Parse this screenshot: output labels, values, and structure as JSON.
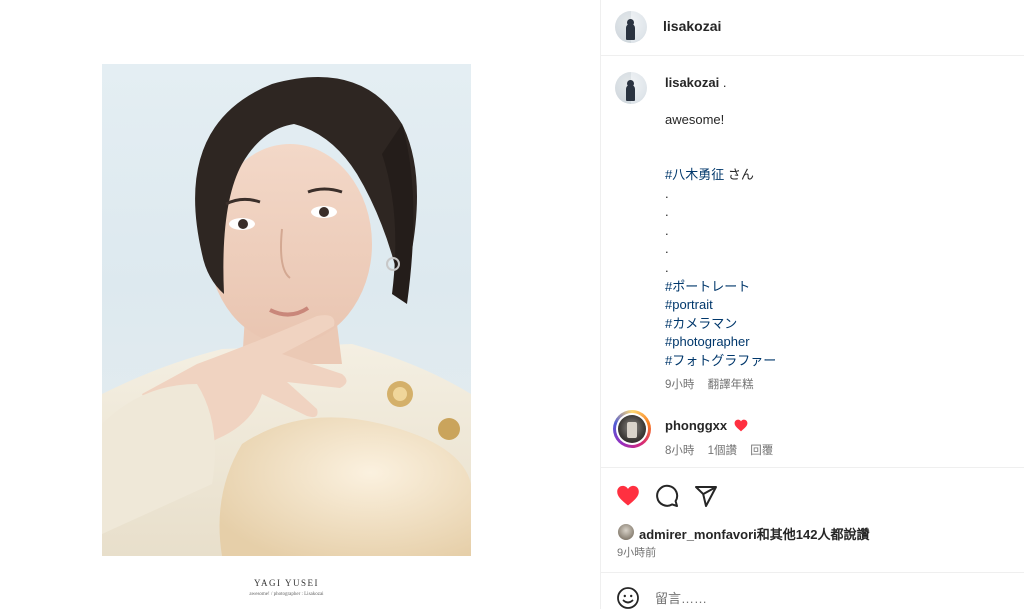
{
  "post": {
    "username": "lisakozai",
    "photo_caption_title": "YAGI YUSEI",
    "photo_caption_sub": "awesome! / photographer : Lisakozai"
  },
  "caption": {
    "username": "lisakozai",
    "username_suffix": " .",
    "text": "awesome!",
    "lines": [
      {
        "text": "#八木勇征",
        "suffix": " さん",
        "type": "hashtag"
      },
      {
        "text": ".",
        "type": "plain"
      },
      {
        "text": ".",
        "type": "plain"
      },
      {
        "text": ".",
        "type": "plain"
      },
      {
        "text": ".",
        "type": "plain"
      },
      {
        "text": ".",
        "type": "plain"
      },
      {
        "text": "#ポートレート",
        "type": "hashtag"
      },
      {
        "text": "#portrait",
        "type": "hashtag"
      },
      {
        "text": "#カメラマン",
        "type": "hashtag"
      },
      {
        "text": "#photographer",
        "type": "hashtag"
      },
      {
        "text": "#フォトグラファー",
        "type": "hashtag"
      }
    ],
    "time": "9小時",
    "translate_label": "翻譯年糕"
  },
  "comment": {
    "username": "phonggxx",
    "emoji": "heart",
    "time": "8小時",
    "likes": "1個讚",
    "reply_label": "回覆"
  },
  "likes": {
    "user": "admirer_monfavori",
    "rest": "和其他142人都說讚",
    "time": "9小時前"
  },
  "add_comment": {
    "placeholder": "留言……"
  },
  "colors": {
    "like_red": "#ff3040",
    "hashtag_blue": "#00376b",
    "meta_gray": "#737373"
  },
  "icons": [
    "heart-filled-icon",
    "comment-icon",
    "share-icon",
    "emoji-icon"
  ]
}
